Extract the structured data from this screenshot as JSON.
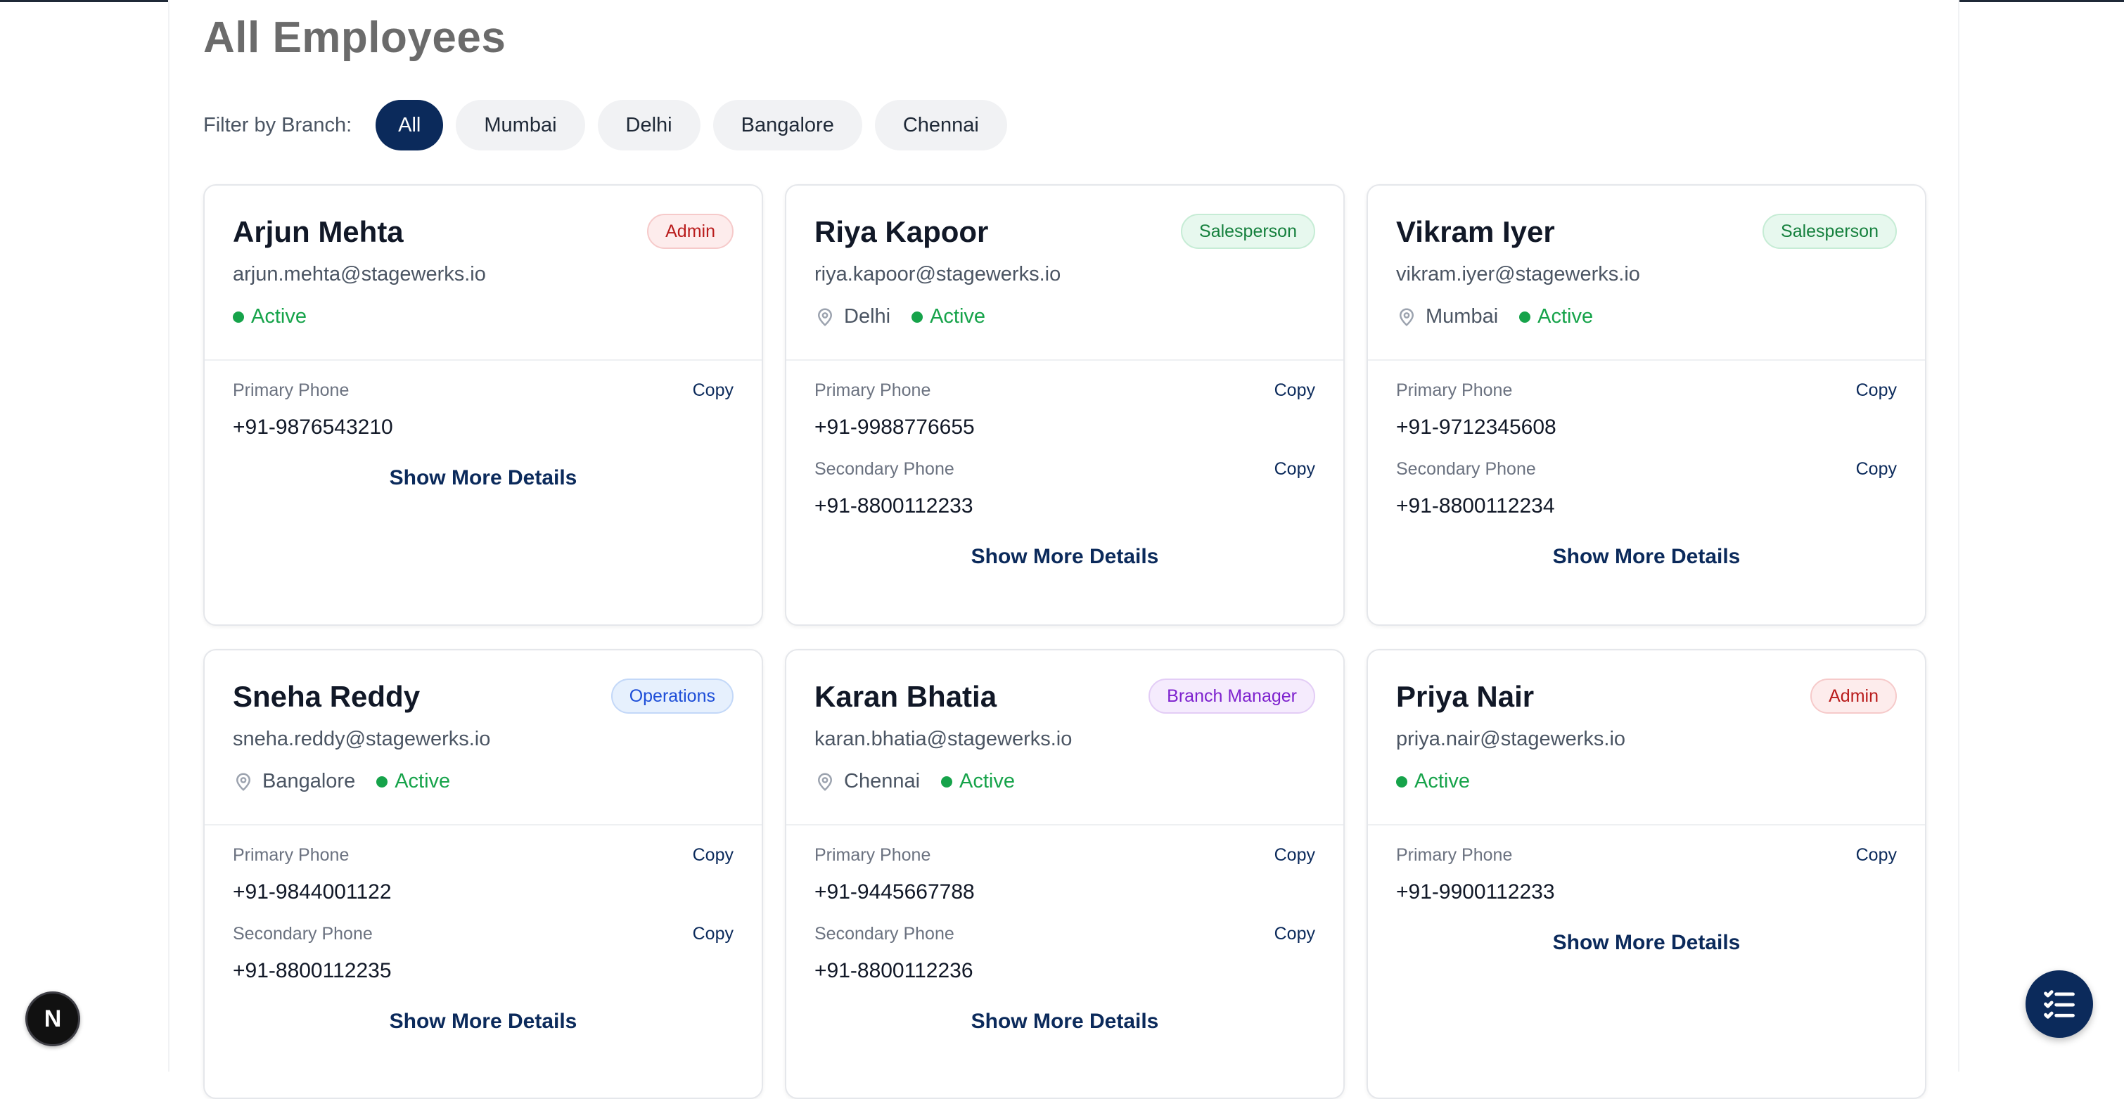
{
  "page": {
    "title": "All Employees"
  },
  "filter": {
    "label": "Filter by Branch:",
    "options": [
      "All",
      "Mumbai",
      "Delhi",
      "Bangalore",
      "Chennai"
    ],
    "selected": "All"
  },
  "labels": {
    "primary_phone": "Primary Phone",
    "secondary_phone": "Secondary Phone",
    "copy": "Copy",
    "show_more": "Show More Details"
  },
  "employees": [
    {
      "name": "Arjun Mehta",
      "email": "arjun.mehta@stagewerks.io",
      "role": "Admin",
      "branch": "",
      "status": "Active",
      "primary_phone": "+91-9876543210",
      "secondary_phone": ""
    },
    {
      "name": "Riya Kapoor",
      "email": "riya.kapoor@stagewerks.io",
      "role": "Salesperson",
      "branch": "Delhi",
      "status": "Active",
      "primary_phone": "+91-9988776655",
      "secondary_phone": "+91-8800112233"
    },
    {
      "name": "Vikram Iyer",
      "email": "vikram.iyer@stagewerks.io",
      "role": "Salesperson",
      "branch": "Mumbai",
      "status": "Active",
      "primary_phone": "+91-9712345608",
      "secondary_phone": "+91-8800112234"
    },
    {
      "name": "Sneha Reddy",
      "email": "sneha.reddy@stagewerks.io",
      "role": "Operations",
      "branch": "Bangalore",
      "status": "Active",
      "primary_phone": "+91-9844001122",
      "secondary_phone": "+91-8800112235"
    },
    {
      "name": "Karan Bhatia",
      "email": "karan.bhatia@stagewerks.io",
      "role": "Branch Manager",
      "branch": "Chennai",
      "status": "Active",
      "primary_phone": "+91-9445667788",
      "secondary_phone": "+91-8800112236"
    },
    {
      "name": "Priya Nair",
      "email": "priya.nair@stagewerks.io",
      "role": "Admin",
      "branch": "",
      "status": "Active",
      "primary_phone": "+91-9900112233",
      "secondary_phone": ""
    }
  ],
  "dev_badge": {
    "letter": "N"
  },
  "colors": {
    "primary": "#0b2a5b",
    "active_status": "#16a34a"
  }
}
